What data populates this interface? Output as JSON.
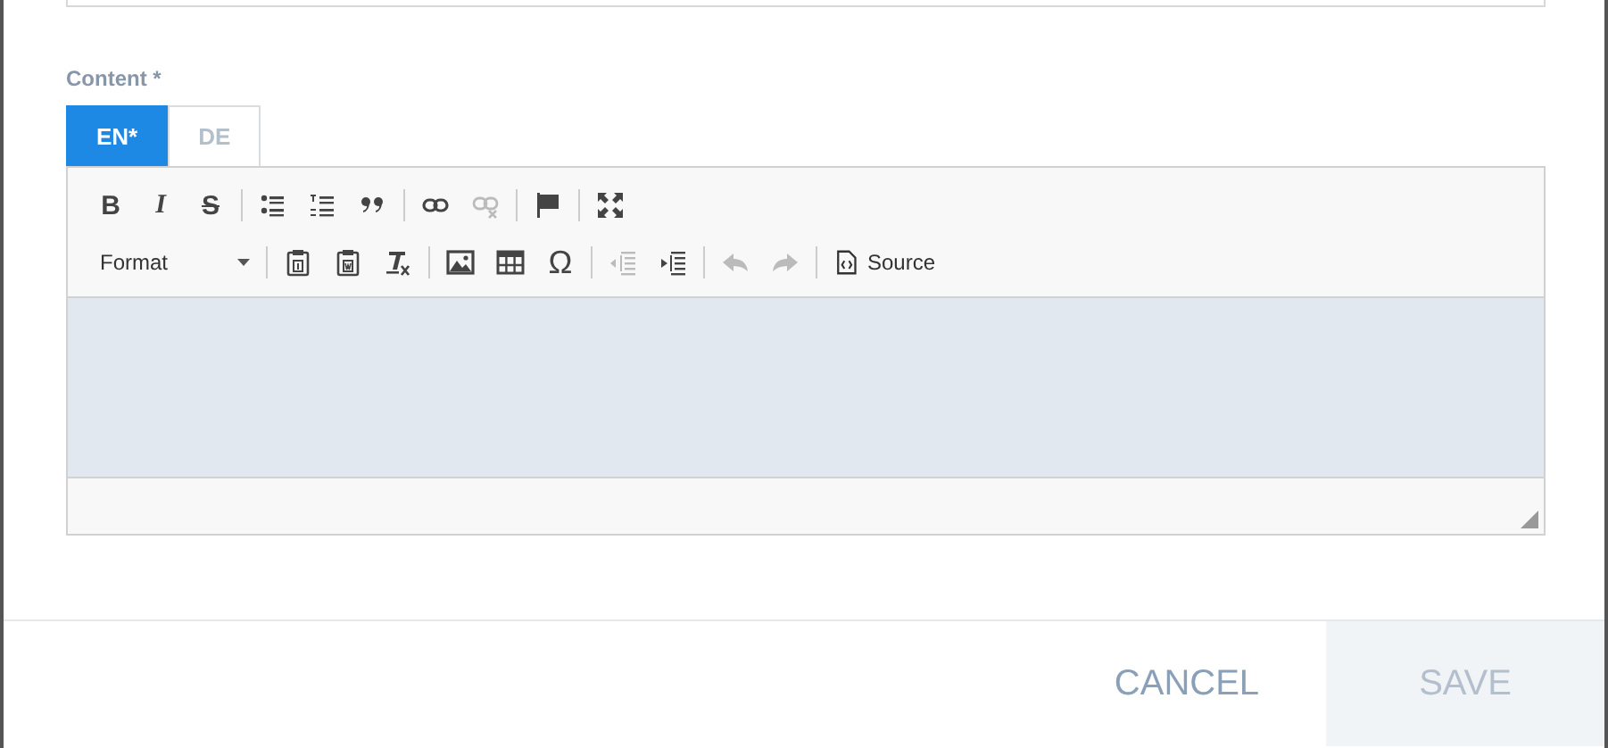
{
  "field": {
    "label": "Content *"
  },
  "tabs": [
    {
      "label": "EN*",
      "selected": true
    },
    {
      "label": "DE",
      "selected": false
    }
  ],
  "toolbar": {
    "rows": [
      [
        {
          "kind": "bold",
          "text": "B",
          "disabled": false
        },
        {
          "kind": "italic",
          "text": "I",
          "disabled": false
        },
        {
          "kind": "strike",
          "text": "S",
          "disabled": false
        },
        {
          "kind": "separator"
        },
        {
          "kind": "bullets",
          "disabled": false
        },
        {
          "kind": "numbers",
          "disabled": false
        },
        {
          "kind": "quote",
          "disabled": false
        },
        {
          "kind": "separator"
        },
        {
          "kind": "link",
          "disabled": false
        },
        {
          "kind": "unlink",
          "disabled": true
        },
        {
          "kind": "separator"
        },
        {
          "kind": "flag",
          "disabled": false
        },
        {
          "kind": "separator"
        },
        {
          "kind": "maximize",
          "disabled": false
        }
      ],
      [
        {
          "kind": "format",
          "text": "Format",
          "disabled": false
        },
        {
          "kind": "separator"
        },
        {
          "kind": "paste-text",
          "disabled": false
        },
        {
          "kind": "paste-word",
          "disabled": false
        },
        {
          "kind": "clear-format",
          "disabled": false
        },
        {
          "kind": "separator"
        },
        {
          "kind": "image",
          "disabled": false
        },
        {
          "kind": "table",
          "disabled": false
        },
        {
          "kind": "omega",
          "text": "Ω",
          "disabled": false
        },
        {
          "kind": "separator"
        },
        {
          "kind": "outdent",
          "disabled": true
        },
        {
          "kind": "indent",
          "disabled": false
        },
        {
          "kind": "separator"
        },
        {
          "kind": "undo",
          "disabled": true
        },
        {
          "kind": "redo",
          "disabled": true
        },
        {
          "kind": "separator"
        },
        {
          "kind": "source",
          "text": "Source",
          "disabled": false
        }
      ]
    ]
  },
  "buttons": [
    {
      "kind": "cancel",
      "label": "CANCEL",
      "disabled": false
    },
    {
      "kind": "save",
      "label": "SAVE",
      "disabled": true
    }
  ]
}
